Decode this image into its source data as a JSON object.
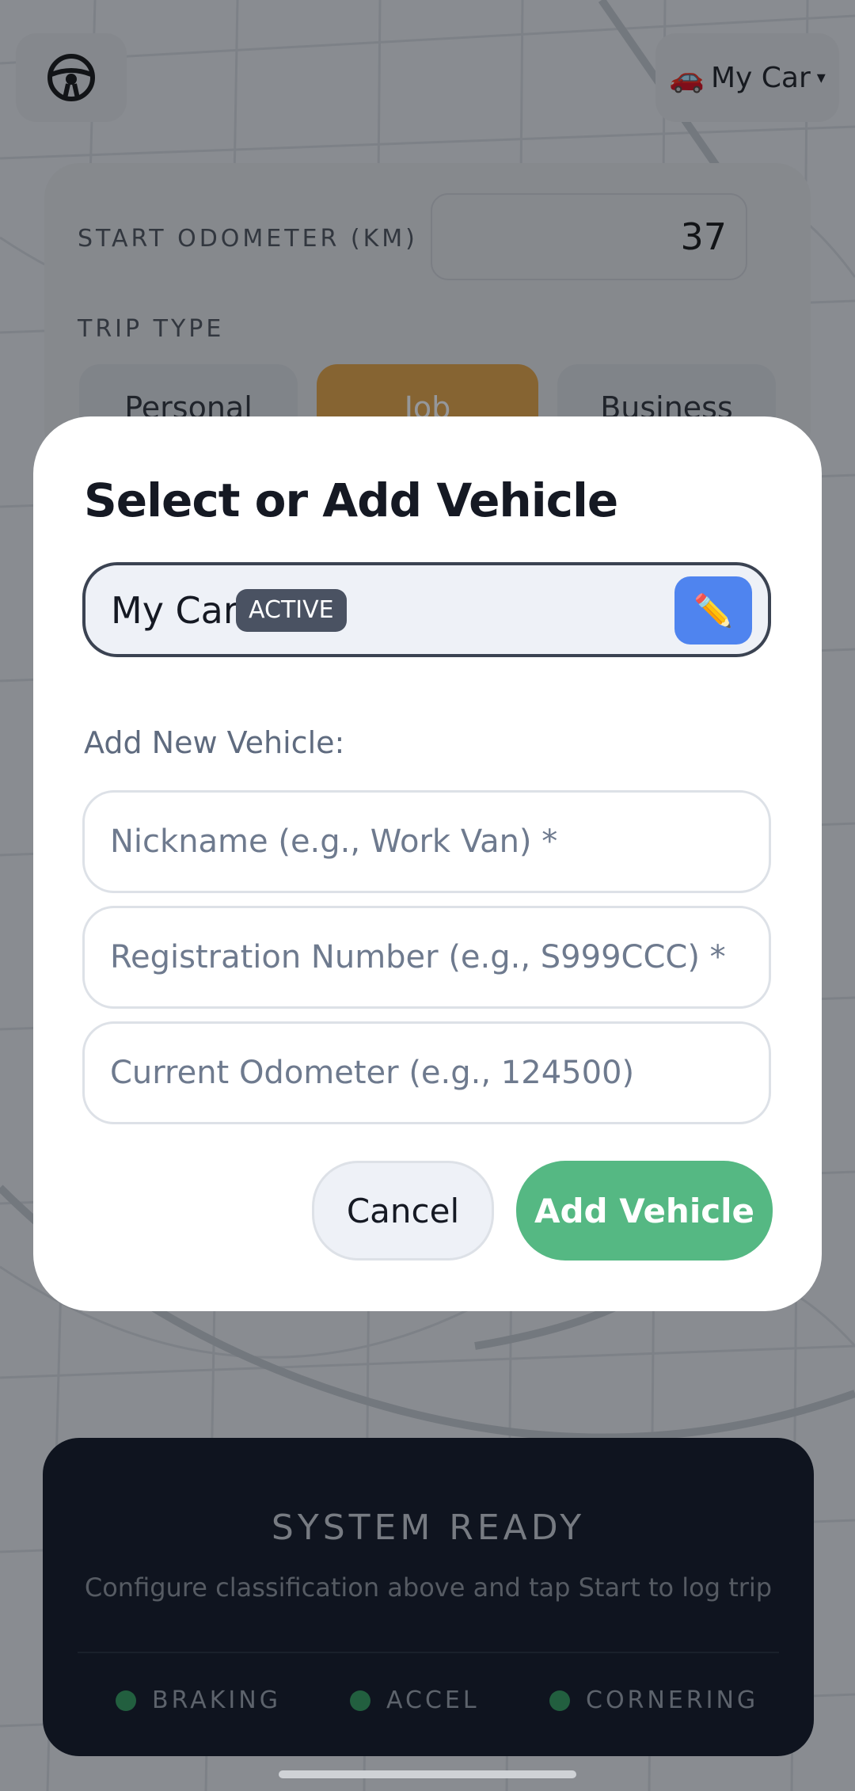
{
  "header": {
    "steering_icon": "steering-wheel-icon",
    "vehicle_emoji": "🚗",
    "vehicle_label": "My Car",
    "caret": "▾"
  },
  "config": {
    "odometer_label": "START ODOMETER (KM)",
    "odometer_value": "37",
    "trip_type_label": "TRIP TYPE",
    "trip_types": [
      "Personal",
      "Job",
      "Business"
    ],
    "selected_trip_type": "Job"
  },
  "status": {
    "title": "SYSTEM READY",
    "subtitle": "Configure classification above and tap Start to log trip",
    "indicators": [
      "BRAKING",
      "ACCEL",
      "CORNERING"
    ]
  },
  "modal": {
    "title": "Select or Add Vehicle",
    "vehicle": {
      "name": "My Car",
      "badge": "ACTIVE",
      "edit_icon": "✏️"
    },
    "add_label": "Add New Vehicle:",
    "fields": {
      "nickname_placeholder": "Nickname (e.g., Work Van) *",
      "registration_placeholder": "Registration Number (e.g., S999CCC) *",
      "odometer_placeholder": "Current Odometer (e.g., 124500)"
    },
    "cancel_label": "Cancel",
    "add_label_button": "Add Vehicle"
  },
  "colors": {
    "accent_blue": "#4f84ef",
    "accent_green": "#55b883",
    "job_orange": "#e3a343",
    "status_bg": "#0b1220"
  }
}
